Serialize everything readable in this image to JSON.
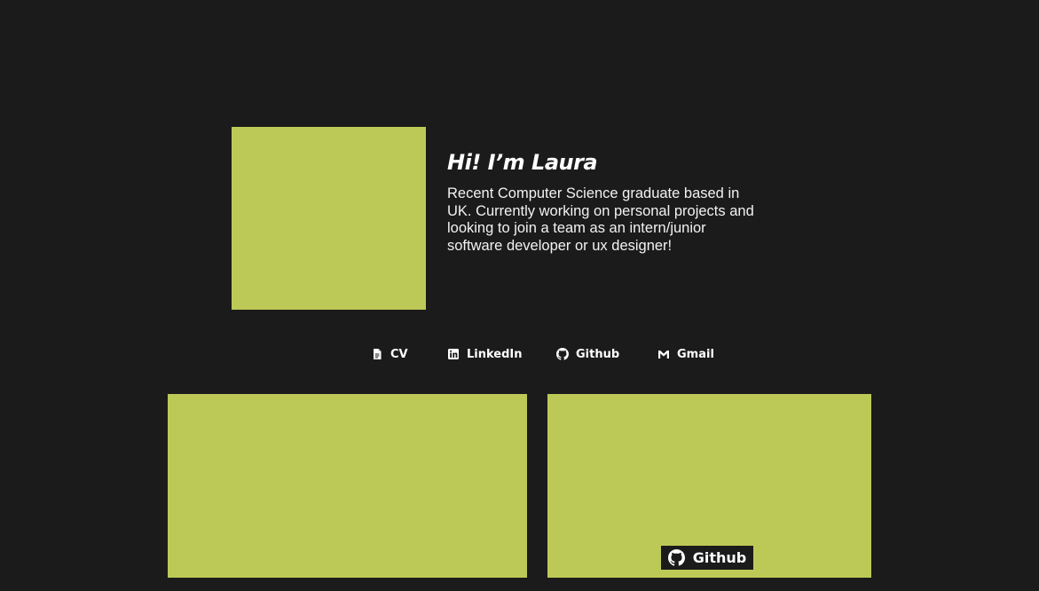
{
  "intro": {
    "heading": "Hi! I’m Laura",
    "bio": "Recent Computer Science graduate based in UK. Currently working on personal projects and looking to join a team as an intern/junior software developer or ux designer!"
  },
  "links": [
    {
      "label": "CV",
      "icon": "document-icon"
    },
    {
      "label": "LinkedIn",
      "icon": "linkedin-icon"
    },
    {
      "label": "Github",
      "icon": "github-icon"
    },
    {
      "label": "Gmail",
      "icon": "gmail-icon"
    }
  ],
  "projects": {
    "card2_button_label": "Github"
  },
  "colors": {
    "background": "#1b1b1b",
    "accent": "#bdc956",
    "text": "#ffffff"
  }
}
